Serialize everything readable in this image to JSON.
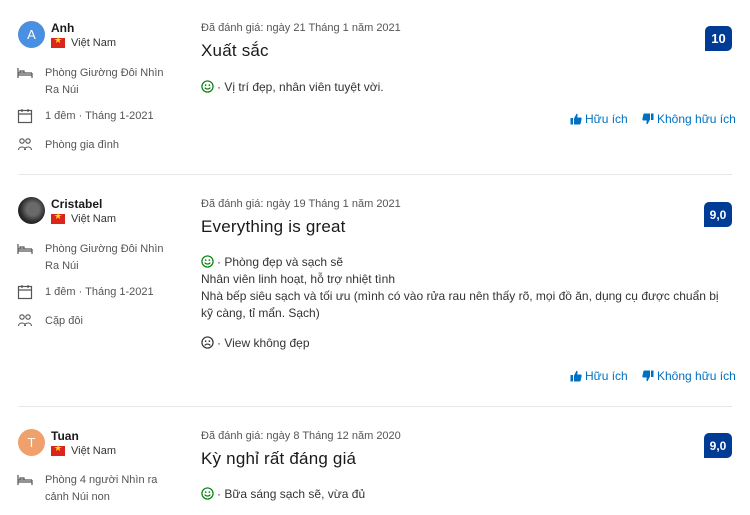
{
  "reviews": [
    {
      "avatar_letter": "A",
      "avatar_color": "#4a90e2",
      "name": "Anh",
      "country": "Việt Nam",
      "room": "Phòng Giường Đôi Nhìn Ra Núi",
      "stay": "1 đêm · Tháng 1-2021",
      "group": "Phòng gia đình",
      "date": "Đã đánh giá: ngày 21 Tháng 1 năm 2021",
      "title": "Xuất sắc",
      "positive": "· Vị trí đẹp, nhân viên tuyệt vời.",
      "score": "10",
      "helpful": "Hữu ích",
      "not_helpful": "Không hữu ích"
    },
    {
      "avatar_letter": "",
      "avatar_color": "#2b2b2b",
      "name": "Cristabel",
      "country": "Việt Nam",
      "room": "Phòng Giường Đôi Nhìn Ra Núi",
      "stay": "1 đêm · Tháng 1-2021",
      "group": "Cặp đôi",
      "date": "Đã đánh giá: ngày 19 Tháng 1 năm 2021",
      "title": "Everything is great",
      "positive_lines": [
        "· Phòng đẹp và sạch sẽ",
        "Nhân viên linh hoạt, hỗ trợ nhiệt tình",
        "Nhà bếp siêu sạch và tối ưu (mình có vào rửa rau nên thấy rõ, mọi đồ ăn, dụng cụ được chuẩn bị kỹ càng, tỉ mẩn. Sạch)"
      ],
      "negative": "· View không đẹp",
      "score": "9,0",
      "helpful": "Hữu ích",
      "not_helpful": "Không hữu ích"
    },
    {
      "avatar_letter": "T",
      "avatar_color": "#f0a06a",
      "name": "Tuan",
      "country": "Việt Nam",
      "room": "Phòng 4 người Nhìn ra cảnh Núi non",
      "date": "Đã đánh giá: ngày 8 Tháng 12 năm 2020",
      "title": "Kỳ nghỉ rất đáng giá",
      "positive": "· Bữa sáng sạch sẽ, vừa đủ",
      "score": "9,0"
    }
  ],
  "colors": {
    "accent": "#0071c2",
    "score_bg": "#003b95",
    "positive": "#008009",
    "negative": "#333333"
  },
  "icons": {
    "room": "bed-icon",
    "stay": "calendar-icon",
    "group": "people-icon",
    "positive": "smile-icon",
    "negative": "frown-icon",
    "helpful": "thumbs-up-icon",
    "not_helpful": "thumbs-down-icon"
  }
}
